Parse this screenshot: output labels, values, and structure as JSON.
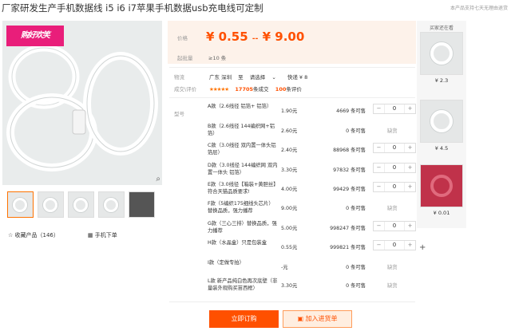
{
  "title": "厂家研发生产手机数据线 i5 i6 i7苹果手机数据usb充电线可定制",
  "notice": "本产品支持七天无理由退货",
  "brand_text": "购好欢笑",
  "price": {
    "label": "价格",
    "low": "¥ 0.55",
    "sep": "--",
    "high": "¥ 9.00",
    "min_label": "起批量",
    "min_value": "≥10 条"
  },
  "shipping": {
    "label": "物流",
    "from": "广东 深圳",
    "to_prefix": "至",
    "select": "请选择",
    "express": "快递 ¥ 8"
  },
  "deal": {
    "label": "成交\\评价",
    "stars": "★★★★★",
    "count": "17705",
    "count_suffix": "条成交",
    "reviews": "100",
    "reviews_suffix": "条评价"
  },
  "models_label": "型号",
  "skus": [
    {
      "name": "A款（2.6线径 铝箔+ 铝箔）",
      "price": "1.90元",
      "stock": "4669 条可售",
      "qty": "0",
      "out": ""
    },
    {
      "name": "B款（2.6线径 144编织网+铝箔）",
      "price": "2.60元",
      "stock": "0 条可售",
      "qty": "",
      "out": "缺货"
    },
    {
      "name": "C款（3.0线径 双内置一体头铝箔层）",
      "price": "2.40元",
      "stock": "88968 条可售",
      "qty": "0",
      "out": ""
    },
    {
      "name": "D款（3.0线径 144编织网 双内置一体头 铝箔）",
      "price": "3.30元",
      "stock": "97832 条可售",
      "qty": "0",
      "out": ""
    },
    {
      "name": "E款（3.0线径【箱装+黄胆丝】符合天猫品质要求!",
      "price": "4.00元",
      "stock": "99429 条可售",
      "qty": "0",
      "out": ""
    },
    {
      "name": "F款（5编织175细线头芯片）替换品质，强力播荐",
      "price": "9.00元",
      "stock": "0 条可售",
      "qty": "",
      "out": "缺货"
    },
    {
      "name": "G款（三心三排）替换品质，强力播荐",
      "price": "5.00元",
      "stock": "998247 条可售",
      "qty": "0",
      "out": ""
    },
    {
      "name": "H款（水晶盒）只是包装盒",
      "price": "0.55元",
      "stock": "999821 条可售",
      "qty": "0",
      "out": ""
    },
    {
      "name": "I款（定做专拍）",
      "price": "-元",
      "stock": "0 条可售",
      "qty": "",
      "out": "缺货"
    },
    {
      "name": "L款 新产品纯白色再次底壁（非量装外观购买苗西框）",
      "price": "3.30元",
      "stock": "0 条可售",
      "qty": "",
      "out": "缺货"
    }
  ],
  "stepper": {
    "minus": "−",
    "plus": "+"
  },
  "buttons": {
    "buy": "立即订购",
    "cart": "加入进货单"
  },
  "links": {
    "collect": "收藏产品（146）",
    "mobile": "手机下单"
  },
  "side": {
    "title": "买家还在看",
    "items": [
      {
        "price": "¥ 2.3"
      },
      {
        "price": "¥ 4.5"
      },
      {
        "price": "¥ 0.01"
      }
    ]
  }
}
